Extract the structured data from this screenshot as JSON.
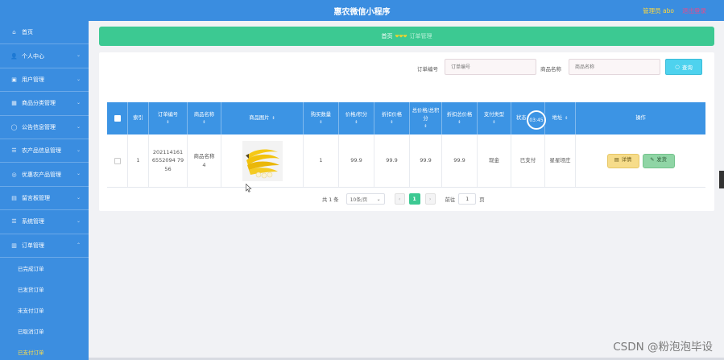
{
  "header": {
    "title": "惠农微信小程序",
    "admin": "管理员 abo",
    "logout": "退出登录"
  },
  "sidebar": {
    "items": [
      {
        "icon": "⌂",
        "label": "首页",
        "chevron": ""
      },
      {
        "icon": "👤",
        "label": "个人中心",
        "chevron": "⌄"
      },
      {
        "icon": "▣",
        "label": "用户管理",
        "chevron": "⌄"
      },
      {
        "icon": "▦",
        "label": "商品分类管理",
        "chevron": "⌄"
      },
      {
        "icon": "◯",
        "label": "公告信息管理",
        "chevron": "⌄"
      },
      {
        "icon": "☰",
        "label": "农产品信息管理",
        "chevron": "⌄"
      },
      {
        "icon": "◎",
        "label": "优惠农产品管理",
        "chevron": "⌄"
      },
      {
        "icon": "▤",
        "label": "留言板管理",
        "chevron": "⌄"
      },
      {
        "icon": "☰",
        "label": "系统管理",
        "chevron": "⌄"
      },
      {
        "icon": "▥",
        "label": "订单管理",
        "chevron": "⌃"
      }
    ],
    "sub_items": [
      {
        "label": "已完成订单"
      },
      {
        "label": "已发货订单"
      },
      {
        "label": "未支付订单"
      },
      {
        "label": "已取消订单"
      },
      {
        "label": "已支付订单"
      }
    ]
  },
  "breadcrumb": {
    "home": "首页",
    "separator": "❤❤❤",
    "current": "订单管理"
  },
  "search": {
    "order_label": "订单编号",
    "order_placeholder": "订单编号",
    "product_label": "商品名称",
    "product_placeholder": "商品名称",
    "button": "查询",
    "button_icon": "search-icon"
  },
  "table": {
    "headers": [
      "索引",
      "订单编号",
      "商品名称",
      "商品图片",
      "购买数量",
      "价格/积分",
      "折扣价格",
      "总价格/总积分",
      "折扣总价格",
      "支付类型",
      "状态",
      "地址",
      "操作"
    ],
    "sort_mark": "⇕",
    "rows": [
      {
        "index": "1",
        "order_no": "2021141616552094 7956",
        "product_name": "商品名称4",
        "quantity": "1",
        "price": "99.9",
        "discount_price": "99.9",
        "total": "99.9",
        "discount_total": "99.9",
        "pay_type": "现金",
        "status": "已支付",
        "address": "星星垭庄",
        "detail_btn": "详情",
        "ship_btn": "发货"
      }
    ]
  },
  "timer": "03:45",
  "pagination": {
    "total": "共 1 条",
    "page_size": "10条/页",
    "current_page": "1",
    "goto_label": "前往",
    "goto_value": "1",
    "page_suffix": "页"
  },
  "watermark": "CSDN @粉泡泡毕设",
  "colors": {
    "primary": "#3a8de0",
    "accent_green": "#3cc992",
    "query_button": "#4ed2ee"
  }
}
